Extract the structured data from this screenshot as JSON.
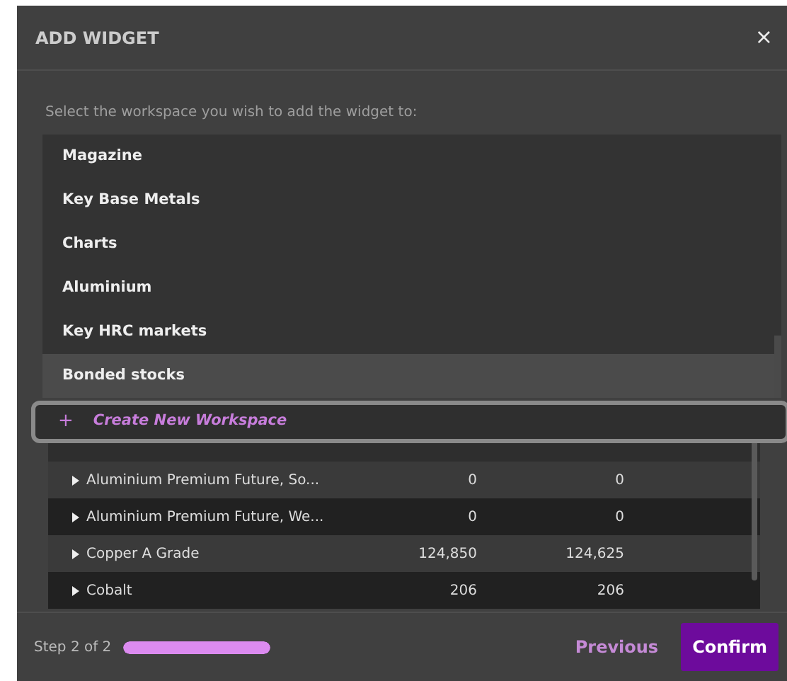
{
  "dialog": {
    "title": "ADD WIDGET",
    "close": "×"
  },
  "instruction": "Select the workspace you wish to add the widget to:",
  "workspaces": [
    {
      "label": "Magazine",
      "selected": false
    },
    {
      "label": "Key Base Metals",
      "selected": false
    },
    {
      "label": "Charts",
      "selected": false
    },
    {
      "label": "Aluminium",
      "selected": false
    },
    {
      "label": "Key HRC markets",
      "selected": false
    },
    {
      "label": "Bonded stocks",
      "selected": true
    }
  ],
  "create_action": {
    "icon": "+",
    "label": "Create New Workspace"
  },
  "table": {
    "rows": [
      {
        "name": "Aluminium Premium Future, So...",
        "column_2": "0",
        "column_3": "0"
      },
      {
        "name": "Aluminium Premium Future, We...",
        "column_2": "0",
        "column_3": "0"
      },
      {
        "name": "Copper A Grade",
        "column_2": "124,850",
        "column_3": "124,625"
      },
      {
        "name": "Cobalt",
        "column_2": "206",
        "column_3": "206"
      }
    ]
  },
  "footer": {
    "step": "Step 2 of 2",
    "progress": {
      "level": 1
    },
    "buttons": [
      {
        "label": "Previous",
        "kind": "link"
      },
      {
        "label": "Confirm",
        "kind": "primary"
      }
    ]
  }
}
